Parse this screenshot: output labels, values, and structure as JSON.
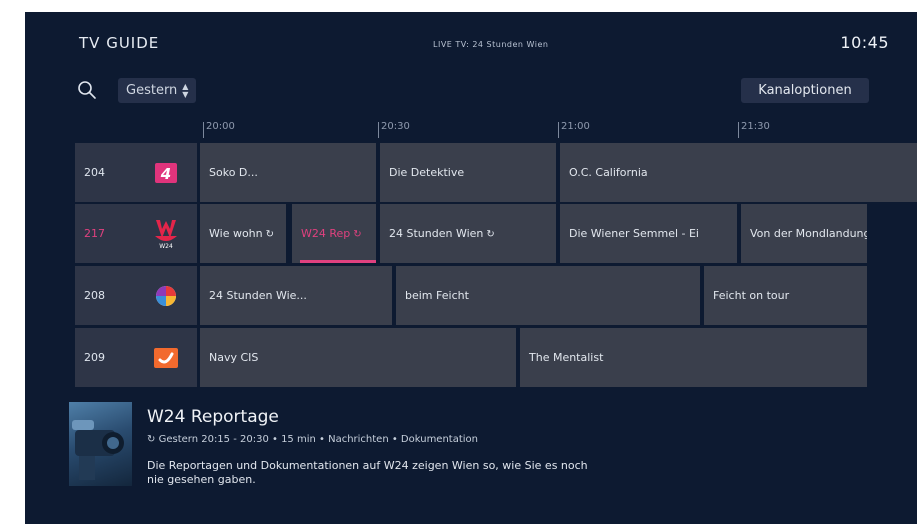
{
  "header": {
    "title": "TV GUIDE",
    "live": "LIVE TV: 24 Stunden Wien",
    "clock": "10:45"
  },
  "toolbar": {
    "search_icon": "search-icon",
    "day": "Gestern",
    "day_arrows": "updown-chevron-icon",
    "options": "Kanaloptionen"
  },
  "timeline": [
    "20:00",
    "20:30",
    "21:00",
    "21:30"
  ],
  "channels": [
    {
      "number": "204",
      "logo": "channel-4-logo",
      "programs": [
        {
          "title": "Soko D..."
        },
        {
          "title": "Die Detektive"
        },
        {
          "title": "O.C. California"
        }
      ]
    },
    {
      "number": "217",
      "logo": "w24-logo",
      "logo_caption": "W24",
      "programs": [
        {
          "title": "Wie wohn",
          "replay": true
        },
        {
          "title": "W24 Rep",
          "replay": true,
          "selected": true
        },
        {
          "title": "24 Stunden Wien",
          "replay": true
        },
        {
          "title": "Die Wiener Semmel - Ei"
        },
        {
          "title": "Von der Mondlandung",
          "replay": true
        }
      ]
    },
    {
      "number": "208",
      "logo": "sat1-logo",
      "programs": [
        {
          "title": "24 Stunden Wie..."
        },
        {
          "title": "beim Feicht"
        },
        {
          "title": "Feicht on tour"
        }
      ]
    },
    {
      "number": "209",
      "logo": "kabel-eins-logo",
      "programs": [
        {
          "title": "Navy CIS"
        },
        {
          "title": "The Mentalist"
        }
      ]
    }
  ],
  "details": {
    "title": "W24 Reportage",
    "meta": "Gestern 20:15 - 20:30 • 15 min • Nachrichten • Dokumentation",
    "description": "Die Reportagen und Dokumentationen auf W24 zeigen Wien so, wie Sie es noch nie gesehen gaben.",
    "replay_icon": "replay-icon"
  },
  "colors": {
    "background": "#0d1a31",
    "accent": "#e0417f",
    "tile": "#3a3f4c",
    "channel_tile": "#2e3547"
  }
}
